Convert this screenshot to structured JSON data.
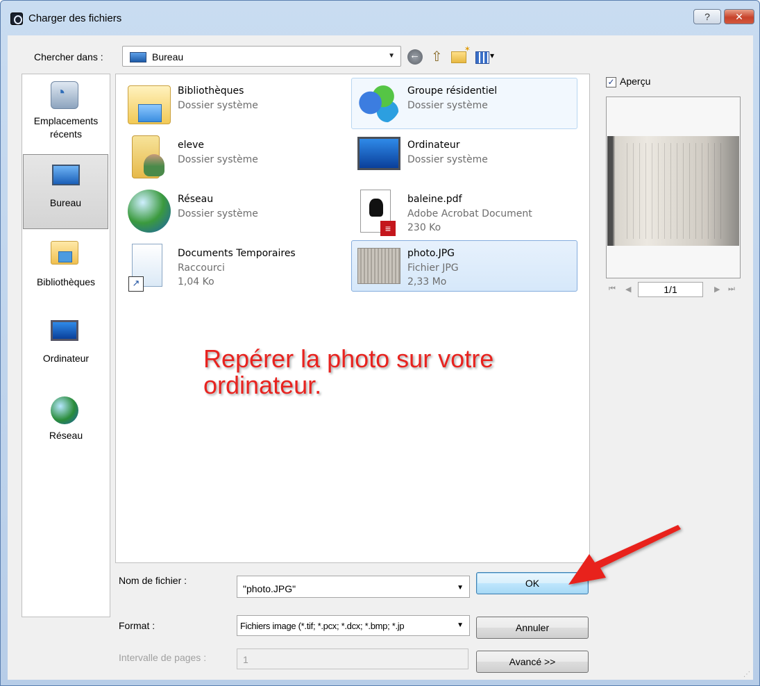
{
  "window": {
    "title": "Charger des fichiers",
    "help_label": "?",
    "close_label": "✕"
  },
  "toolbar": {
    "lookin_label": "Chercher dans :",
    "lookin_value": "Bureau"
  },
  "places": [
    {
      "label": "Emplacements récents",
      "icon": "recent-places-icon"
    },
    {
      "label": "Bureau",
      "icon": "desktop-icon",
      "active": true
    },
    {
      "label": "Bibliothèques",
      "icon": "libraries-icon"
    },
    {
      "label": "Ordinateur",
      "icon": "computer-icon"
    },
    {
      "label": "Réseau",
      "icon": "network-icon"
    }
  ],
  "files": [
    {
      "name": "Bibliothèques",
      "type": "Dossier système",
      "size": "",
      "icon": "libraries-folder-icon"
    },
    {
      "name": "Groupe résidentiel",
      "type": "Dossier système",
      "size": "",
      "icon": "homegroup-icon"
    },
    {
      "name": "eleve",
      "type": "Dossier système",
      "size": "",
      "icon": "user-folder-icon"
    },
    {
      "name": "Ordinateur",
      "type": "Dossier système",
      "size": "",
      "icon": "computer-icon"
    },
    {
      "name": "Réseau",
      "type": "Dossier système",
      "size": "",
      "icon": "network-icon"
    },
    {
      "name": "baleine.pdf",
      "type": "Adobe Acrobat Document",
      "size": "230 Ko",
      "icon": "pdf-file-icon"
    },
    {
      "name": "Documents Temporaires",
      "type": "Raccourci",
      "size": "1,04 Ko",
      "icon": "shortcut-icon"
    },
    {
      "name": "photo.JPG",
      "type": "Fichier JPG",
      "size": "2,33 Mo",
      "icon": "jpg-file-icon",
      "selected": true
    }
  ],
  "preview": {
    "checkbox_label": "Aperçu",
    "checked": true,
    "page_indicator": "1/1"
  },
  "form": {
    "filename_label": "Nom de fichier :",
    "filename_value": "\"photo.JPG\"",
    "format_label": "Format :",
    "format_value": "Fichiers image (*.tif; *.pcx; *.dcx; *.bmp; *.jp",
    "range_label": "Intervalle de pages :",
    "range_value": "1"
  },
  "buttons": {
    "ok": "OK",
    "cancel": "Annuler",
    "advanced": "Avancé >>"
  },
  "annotation": {
    "text": "Repérer la photo sur votre ordinateur.",
    "color": "#e8231f"
  },
  "colors": {
    "selection": "#d6e8fa",
    "title_gradient": "#c9dcf1"
  }
}
